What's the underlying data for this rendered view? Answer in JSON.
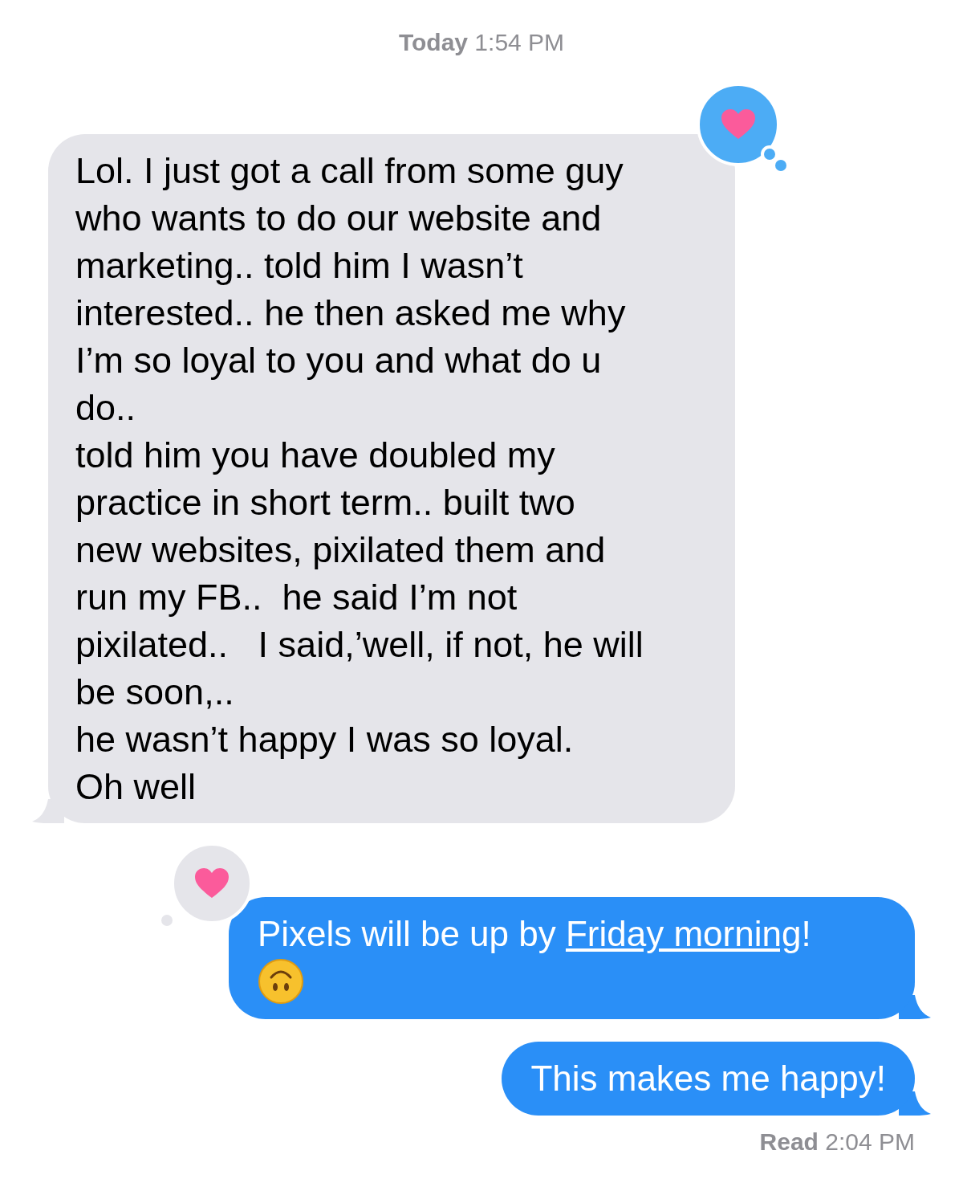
{
  "timestamp": "**Today** 1:54 PM",
  "messages": [
    {
      "kind": "incoming",
      "tapback": {
        "kind": "heart"
      },
      "text": "Lol. I just got a call from some guy\nwho wants to do our website and\nmarketing.. told him I wasn’t\ninterested.. he then asked me why\nI’m so loyal to you and what do u\ndo..\ntold him you have doubled my\npractice in short term.. built two\nnew websites, pixilated them and\nrun my FB..  he said I’m not\npixilated..   I said,’well, if not, he will\nbe soon,..\nhe wasn’t happy I was so loyal.\nOh well"
    },
    {
      "kind": "outgoing",
      "tapback": {
        "kind": "heart"
      },
      "parts": [
        {
          "kind": "text",
          "text": "Pixels will be up by "
        },
        {
          "kind": "link",
          "text": "Friday morning"
        },
        {
          "kind": "text",
          "text": "!"
        },
        {
          "kind": "emoji"
        }
      ]
    },
    {
      "kind": "outgoing",
      "parts": [
        {
          "kind": "text",
          "text": "This makes me happy!"
        }
      ]
    }
  ],
  "read_receipt": "**Read** 2:04 PM"
}
